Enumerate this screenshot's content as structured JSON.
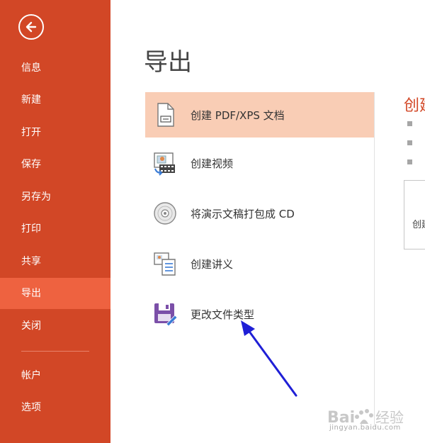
{
  "sidebar": {
    "items": [
      {
        "label": "信息"
      },
      {
        "label": "新建"
      },
      {
        "label": "打开"
      },
      {
        "label": "保存"
      },
      {
        "label": "另存为"
      },
      {
        "label": "打印"
      },
      {
        "label": "共享"
      },
      {
        "label": "导出"
      },
      {
        "label": "关闭"
      },
      {
        "label": "帐户"
      },
      {
        "label": "选项"
      }
    ],
    "active": "导出"
  },
  "main": {
    "title": "导出",
    "export_options": [
      {
        "label": "创建 PDF/XPS 文档",
        "icon": "pdf-document-icon"
      },
      {
        "label": "创建视频",
        "icon": "video-icon"
      },
      {
        "label": "将演示文稿打包成 CD",
        "icon": "cd-icon"
      },
      {
        "label": "创建讲义",
        "icon": "handout-icon"
      },
      {
        "label": "更改文件类型",
        "icon": "floppy-save-icon"
      }
    ]
  },
  "detail": {
    "title": "创建",
    "button_label": "创建"
  },
  "watermark": {
    "brand": "Bai",
    "brand2": "经验",
    "url": "jingyan.baidu.com"
  },
  "colors": {
    "sidebar": "#d24726",
    "active": "#ee6240",
    "selected": "#f9cdb5",
    "annotation_arrow": "#1f1fd6"
  }
}
